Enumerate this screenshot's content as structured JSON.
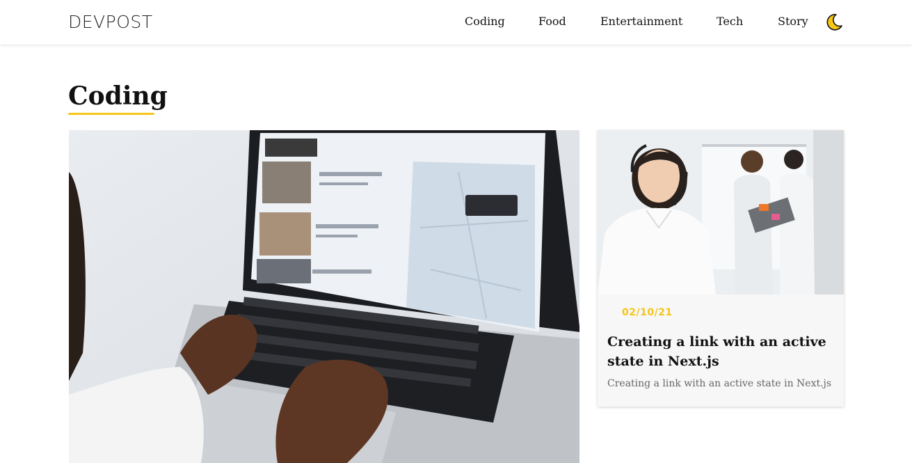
{
  "header": {
    "logo": "DEVPOST",
    "nav": [
      {
        "label": "Coding"
      },
      {
        "label": "Food"
      },
      {
        "label": "Entertainment"
      },
      {
        "label": "Tech"
      },
      {
        "label": "Story"
      }
    ],
    "theme_toggle_icon": "moon-icon"
  },
  "main": {
    "section_title": "Coding",
    "featured_image": "laptop-typing-photo",
    "card": {
      "image": "office-headset-woman-photo",
      "date": "02/10/21",
      "title": "Creating a link with an active state in Next.js",
      "excerpt": "Creating a link with an active state in Next.js"
    }
  },
  "colors": {
    "accent": "#f5c518",
    "text": "#111111",
    "muted": "#666666",
    "card_bg": "#f7f7f7"
  }
}
